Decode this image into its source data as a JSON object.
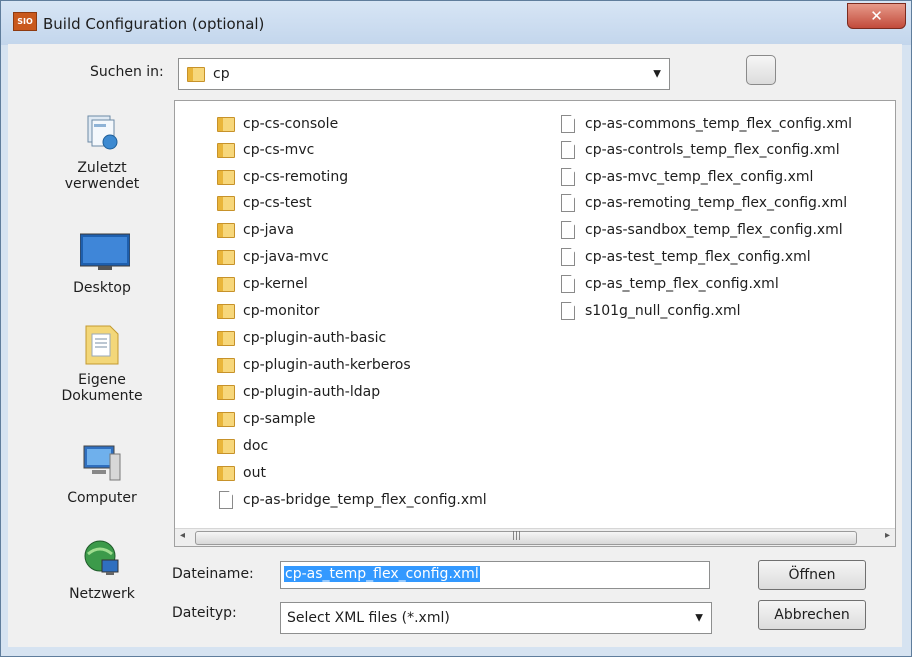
{
  "window": {
    "title": "Build Configuration (optional)",
    "app_icon_text": "SIO",
    "close_symbol": "✕"
  },
  "lookin": {
    "label": "Suchen in:",
    "value": "cp"
  },
  "places": [
    {
      "label_line1": "Zuletzt",
      "label_line2": "verwendet",
      "icon": "recent-places-icon"
    },
    {
      "label_line1": "Desktop",
      "label_line2": "",
      "icon": "desktop-icon"
    },
    {
      "label_line1": "Eigene",
      "label_line2": "Dokumente",
      "icon": "documents-icon"
    },
    {
      "label_line1": "Computer",
      "label_line2": "",
      "icon": "computer-icon"
    },
    {
      "label_line1": "Netzwerk",
      "label_line2": "",
      "icon": "network-icon"
    }
  ],
  "files": {
    "column1": [
      {
        "name": "cp-cs-console",
        "type": "folder"
      },
      {
        "name": "cp-cs-mvc",
        "type": "folder"
      },
      {
        "name": "cp-cs-remoting",
        "type": "folder"
      },
      {
        "name": "cp-cs-test",
        "type": "folder"
      },
      {
        "name": "cp-java",
        "type": "folder"
      },
      {
        "name": "cp-java-mvc",
        "type": "folder"
      },
      {
        "name": "cp-kernel",
        "type": "folder"
      },
      {
        "name": "cp-monitor",
        "type": "folder"
      },
      {
        "name": "cp-plugin-auth-basic",
        "type": "folder"
      },
      {
        "name": "cp-plugin-auth-kerberos",
        "type": "folder"
      },
      {
        "name": "cp-plugin-auth-ldap",
        "type": "folder"
      },
      {
        "name": "cp-sample",
        "type": "folder"
      },
      {
        "name": "doc",
        "type": "folder"
      },
      {
        "name": "out",
        "type": "folder"
      },
      {
        "name": "cp-as-bridge_temp_flex_config.xml",
        "type": "file"
      }
    ],
    "column2": [
      {
        "name": "cp-as-commons_temp_flex_config.xml",
        "type": "file"
      },
      {
        "name": "cp-as-controls_temp_flex_config.xml",
        "type": "file"
      },
      {
        "name": "cp-as-mvc_temp_flex_config.xml",
        "type": "file"
      },
      {
        "name": "cp-as-remoting_temp_flex_config.xml",
        "type": "file"
      },
      {
        "name": "cp-as-sandbox_temp_flex_config.xml",
        "type": "file"
      },
      {
        "name": "cp-as-test_temp_flex_config.xml",
        "type": "file"
      },
      {
        "name": "cp-as_temp_flex_config.xml",
        "type": "file"
      },
      {
        "name": "s101g_null_config.xml",
        "type": "file"
      }
    ]
  },
  "filename": {
    "label": "Dateiname:",
    "value": "cp-as_temp_flex_config.xml"
  },
  "filetype": {
    "label": "Dateityp:",
    "value": "Select XML files (*.xml)"
  },
  "buttons": {
    "open": "Öffnen",
    "cancel": "Abbrechen"
  },
  "scrollbar": {
    "left_arrow": "◂",
    "right_arrow": "▸",
    "grip": "|||"
  }
}
